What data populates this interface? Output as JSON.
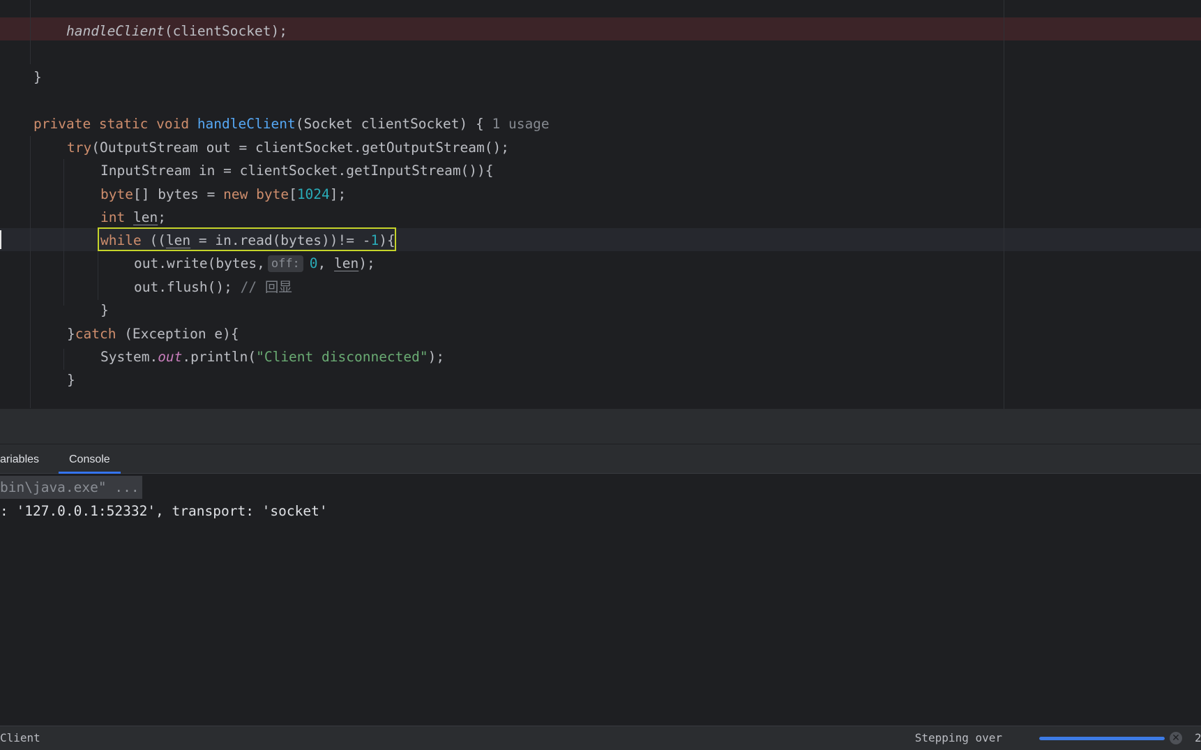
{
  "editor": {
    "breakpoint_line": {
      "indent": "    ",
      "method": "handleClient",
      "args": "(clientSocket);"
    },
    "close_brace_1": "}",
    "method_sig": {
      "mods": "private static void",
      "name": "handleClient",
      "params": "(Socket clientSocket) {",
      "hint": "1 usage"
    },
    "try_line": {
      "kw": "try",
      "rest": "(OutputStream out = clientSocket.getOutputStream();"
    },
    "input_line": "InputStream in = clientSocket.getInputStream()){",
    "bytes_line": {
      "kw1": "byte",
      "mid1": "[] bytes = ",
      "kw2": "new",
      "kw3": "byte",
      "open": "[",
      "num": "1024",
      "close": "];"
    },
    "int_line": {
      "kw": "int",
      "var": "len",
      "end": ";"
    },
    "while_line": {
      "kw": "while",
      "p1": " ((",
      "var": "len",
      "p2": " = in.read(bytes))!= -",
      "num": "1",
      "p3": "){"
    },
    "write_line": {
      "p1": "out.write(bytes,",
      "inlay": "off:",
      "num": "0",
      "p2": ", ",
      "var": "len",
      "p3": ");"
    },
    "flush_line": {
      "code": "out.flush(); ",
      "comment": "// 回显"
    },
    "close_brace_2": "}",
    "catch_line": {
      "p1": "}",
      "kw": "catch",
      "p2": " (Exception e){"
    },
    "println_line": {
      "p1": "System.",
      "field": "out",
      "p2": ".println(",
      "str": "\"Client disconnected\"",
      "p3": ");"
    },
    "close_brace_3": "}"
  },
  "tabs": {
    "variables": "ariables",
    "console": "Console"
  },
  "console": {
    "cmd": "bin\\java.exe\" ...",
    "connected": ": '127.0.0.1:52332', transport: 'socket'"
  },
  "statusbar": {
    "left": "Client",
    "task": "Stepping over",
    "progress": 1.0,
    "right": "2"
  },
  "colors": {
    "keyword": "#cf8e6d",
    "function": "#56a8f5",
    "number": "#2aacb8",
    "string": "#6aab73",
    "breakpoint_row": "#3c2428",
    "exec_frame": "#c6d42a",
    "accent": "#3574f0"
  }
}
